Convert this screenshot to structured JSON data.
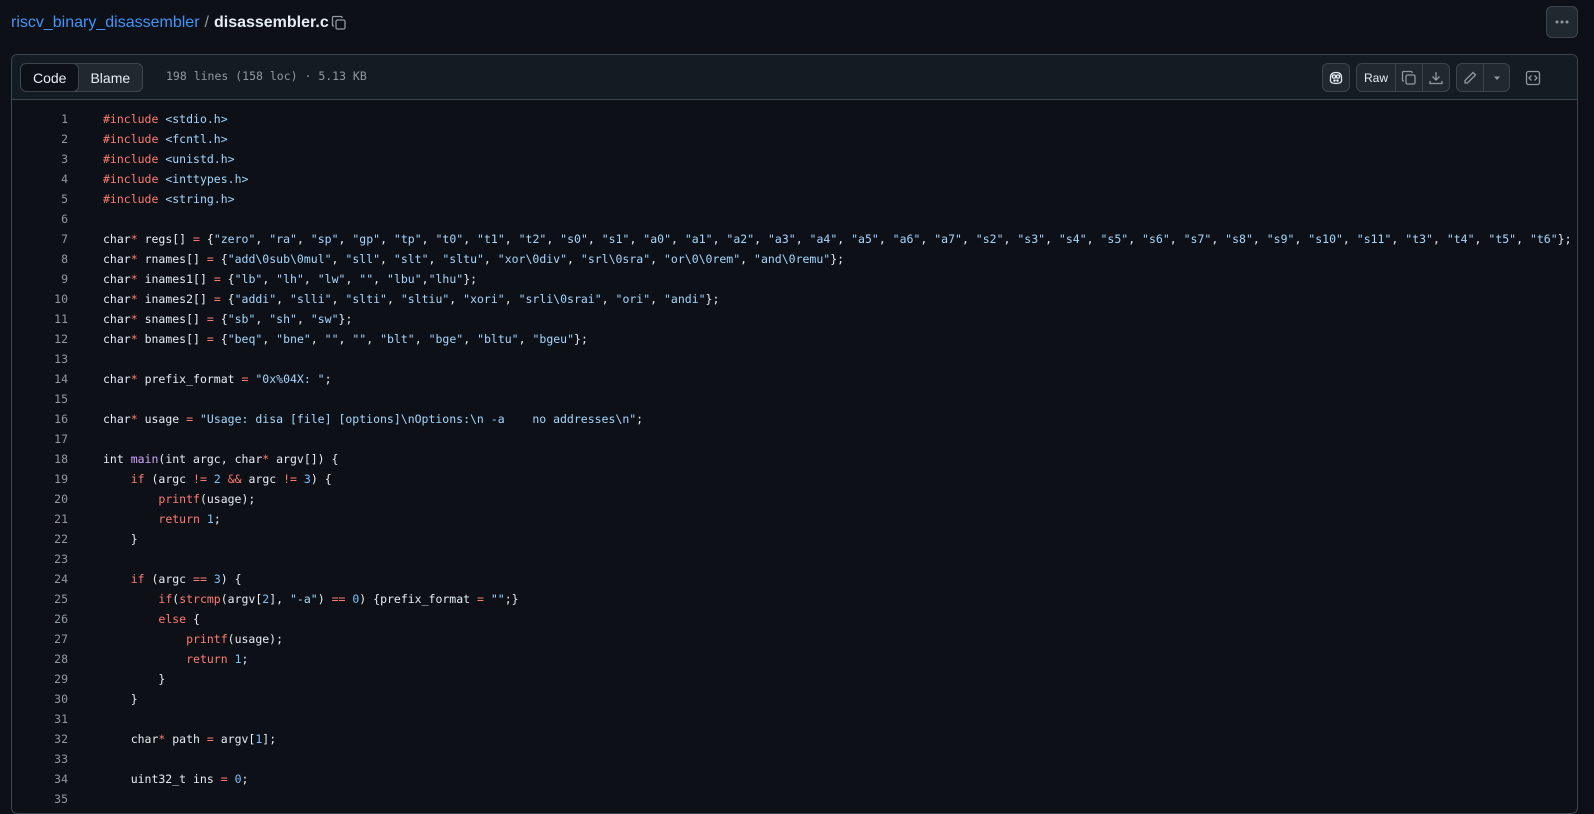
{
  "breadcrumb": {
    "repo": "riscv_binary_disassembler",
    "separator": "/",
    "file": "disassembler.c"
  },
  "icons": {
    "copy_path": "copy-icon",
    "more": "kebab-horizontal-icon",
    "copilot": "copilot-icon",
    "copy_raw": "copy-icon",
    "download": "download-icon",
    "edit": "pencil-icon",
    "dropdown": "triangle-down-icon",
    "symbols": "code-square-icon"
  },
  "tabs": {
    "code": "Code",
    "blame": "Blame",
    "active": "code"
  },
  "file_info": "198 lines (158 loc) · 5.13 KB",
  "toolbar": {
    "raw": "Raw"
  },
  "colors": {
    "keyword": "#ff7b72",
    "string": "#a5d6ff",
    "number": "#79c0ff",
    "function": "#d2a8ff",
    "link": "#4493f8"
  },
  "code_lines": [
    {
      "n": "1",
      "t": [
        [
          "kw",
          "#include"
        ],
        [
          "",
          "&nbsp;"
        ],
        [
          "str",
          "<stdio.h>"
        ]
      ]
    },
    {
      "n": "2",
      "t": [
        [
          "kw",
          "#include"
        ],
        [
          "",
          "&nbsp;"
        ],
        [
          "str",
          "<fcntl.h>"
        ]
      ]
    },
    {
      "n": "3",
      "t": [
        [
          "kw",
          "#include"
        ],
        [
          "",
          "&nbsp;"
        ],
        [
          "str",
          "<unistd.h>"
        ]
      ]
    },
    {
      "n": "4",
      "t": [
        [
          "kw",
          "#include"
        ],
        [
          "",
          "&nbsp;"
        ],
        [
          "str",
          "<inttypes.h>"
        ]
      ]
    },
    {
      "n": "5",
      "t": [
        [
          "kw",
          "#include"
        ],
        [
          "",
          "&nbsp;"
        ],
        [
          "str",
          "<string.h>"
        ]
      ]
    },
    {
      "n": "6",
      "t": []
    },
    {
      "n": "7",
      "t": [
        [
          "",
          "char"
        ],
        [
          "kw",
          "*"
        ],
        [
          "",
          "&nbsp;regs[] "
        ],
        [
          "kw",
          "="
        ],
        [
          "",
          "&nbsp;{"
        ],
        [
          "str",
          "\"zero\""
        ],
        [
          "",
          ", "
        ],
        [
          "str",
          "\"ra\""
        ],
        [
          "",
          ", "
        ],
        [
          "str",
          "\"sp\""
        ],
        [
          "",
          ", "
        ],
        [
          "str",
          "\"gp\""
        ],
        [
          "",
          ", "
        ],
        [
          "str",
          "\"tp\""
        ],
        [
          "",
          ", "
        ],
        [
          "str",
          "\"t0\""
        ],
        [
          "",
          ", "
        ],
        [
          "str",
          "\"t1\""
        ],
        [
          "",
          ", "
        ],
        [
          "str",
          "\"t2\""
        ],
        [
          "",
          ", "
        ],
        [
          "str",
          "\"s0\""
        ],
        [
          "",
          ", "
        ],
        [
          "str",
          "\"s1\""
        ],
        [
          "",
          ", "
        ],
        [
          "str",
          "\"a0\""
        ],
        [
          "",
          ", "
        ],
        [
          "str",
          "\"a1\""
        ],
        [
          "",
          ", "
        ],
        [
          "str",
          "\"a2\""
        ],
        [
          "",
          ", "
        ],
        [
          "str",
          "\"a3\""
        ],
        [
          "",
          ", "
        ],
        [
          "str",
          "\"a4\""
        ],
        [
          "",
          ", "
        ],
        [
          "str",
          "\"a5\""
        ],
        [
          "",
          ", "
        ],
        [
          "str",
          "\"a6\""
        ],
        [
          "",
          ", "
        ],
        [
          "str",
          "\"a7\""
        ],
        [
          "",
          ", "
        ],
        [
          "str",
          "\"s2\""
        ],
        [
          "",
          ", "
        ],
        [
          "str",
          "\"s3\""
        ],
        [
          "",
          ", "
        ],
        [
          "str",
          "\"s4\""
        ],
        [
          "",
          ", "
        ],
        [
          "str",
          "\"s5\""
        ],
        [
          "",
          ", "
        ],
        [
          "str",
          "\"s6\""
        ],
        [
          "",
          ", "
        ],
        [
          "str",
          "\"s7\""
        ],
        [
          "",
          ", "
        ],
        [
          "str",
          "\"s8\""
        ],
        [
          "",
          ", "
        ],
        [
          "str",
          "\"s9\""
        ],
        [
          "",
          ", "
        ],
        [
          "str",
          "\"s10\""
        ],
        [
          "",
          ", "
        ],
        [
          "str",
          "\"s11\""
        ],
        [
          "",
          ", "
        ],
        [
          "str",
          "\"t3\""
        ],
        [
          "",
          ", "
        ],
        [
          "str",
          "\"t4\""
        ],
        [
          "",
          ", "
        ],
        [
          "str",
          "\"t5\""
        ],
        [
          "",
          ", "
        ],
        [
          "str",
          "\"t6\""
        ],
        [
          "",
          "};"
        ]
      ]
    },
    {
      "n": "8",
      "t": [
        [
          "",
          "char"
        ],
        [
          "kw",
          "*"
        ],
        [
          "",
          "&nbsp;rnames[] "
        ],
        [
          "kw",
          "="
        ],
        [
          "",
          "&nbsp;{"
        ],
        [
          "str",
          "\"add\\0sub\\0mul\""
        ],
        [
          "",
          ", "
        ],
        [
          "str",
          "\"sll\""
        ],
        [
          "",
          ", "
        ],
        [
          "str",
          "\"slt\""
        ],
        [
          "",
          ", "
        ],
        [
          "str",
          "\"sltu\""
        ],
        [
          "",
          ", "
        ],
        [
          "str",
          "\"xor\\0div\""
        ],
        [
          "",
          ", "
        ],
        [
          "str",
          "\"srl\\0sra\""
        ],
        [
          "",
          ", "
        ],
        [
          "str",
          "\"or\\0\\0rem\""
        ],
        [
          "",
          ", "
        ],
        [
          "str",
          "\"and\\0remu\""
        ],
        [
          "",
          "};"
        ]
      ]
    },
    {
      "n": "9",
      "t": [
        [
          "",
          "char"
        ],
        [
          "kw",
          "*"
        ],
        [
          "",
          "&nbsp;inames1[] "
        ],
        [
          "kw",
          "="
        ],
        [
          "",
          "&nbsp;{"
        ],
        [
          "str",
          "\"lb\""
        ],
        [
          "",
          ", "
        ],
        [
          "str",
          "\"lh\""
        ],
        [
          "",
          ", "
        ],
        [
          "str",
          "\"lw\""
        ],
        [
          "",
          ", "
        ],
        [
          "str",
          "\"\""
        ],
        [
          "",
          ", "
        ],
        [
          "str",
          "\"lbu\""
        ],
        [
          "",
          ","
        ],
        [
          "str",
          "\"lhu\""
        ],
        [
          "",
          "};"
        ]
      ]
    },
    {
      "n": "10",
      "t": [
        [
          "",
          "char"
        ],
        [
          "kw",
          "*"
        ],
        [
          "",
          "&nbsp;inames2[] "
        ],
        [
          "kw",
          "="
        ],
        [
          "",
          "&nbsp;{"
        ],
        [
          "str",
          "\"addi\""
        ],
        [
          "",
          ", "
        ],
        [
          "str",
          "\"slli\""
        ],
        [
          "",
          ", "
        ],
        [
          "str",
          "\"slti\""
        ],
        [
          "",
          ", "
        ],
        [
          "str",
          "\"sltiu\""
        ],
        [
          "",
          ", "
        ],
        [
          "str",
          "\"xori\""
        ],
        [
          "",
          ", "
        ],
        [
          "str",
          "\"srli\\0srai\""
        ],
        [
          "",
          ", "
        ],
        [
          "str",
          "\"ori\""
        ],
        [
          "",
          ", "
        ],
        [
          "str",
          "\"andi\""
        ],
        [
          "",
          "};"
        ]
      ]
    },
    {
      "n": "11",
      "t": [
        [
          "",
          "char"
        ],
        [
          "kw",
          "*"
        ],
        [
          "",
          "&nbsp;snames[] "
        ],
        [
          "kw",
          "="
        ],
        [
          "",
          "&nbsp;{"
        ],
        [
          "str",
          "\"sb\""
        ],
        [
          "",
          ", "
        ],
        [
          "str",
          "\"sh\""
        ],
        [
          "",
          ", "
        ],
        [
          "str",
          "\"sw\""
        ],
        [
          "",
          "};"
        ]
      ]
    },
    {
      "n": "12",
      "t": [
        [
          "",
          "char"
        ],
        [
          "kw",
          "*"
        ],
        [
          "",
          "&nbsp;bnames[] "
        ],
        [
          "kw",
          "="
        ],
        [
          "",
          "&nbsp;{"
        ],
        [
          "str",
          "\"beq\""
        ],
        [
          "",
          ", "
        ],
        [
          "str",
          "\"bne\""
        ],
        [
          "",
          ", "
        ],
        [
          "str",
          "\"\""
        ],
        [
          "",
          ", "
        ],
        [
          "str",
          "\"\""
        ],
        [
          "",
          ", "
        ],
        [
          "str",
          "\"blt\""
        ],
        [
          "",
          ", "
        ],
        [
          "str",
          "\"bge\""
        ],
        [
          "",
          ", "
        ],
        [
          "str",
          "\"bltu\""
        ],
        [
          "",
          ", "
        ],
        [
          "str",
          "\"bgeu\""
        ],
        [
          "",
          "};"
        ]
      ]
    },
    {
      "n": "13",
      "t": []
    },
    {
      "n": "14",
      "t": [
        [
          "",
          "char"
        ],
        [
          "kw",
          "*"
        ],
        [
          "",
          "&nbsp;prefix_format "
        ],
        [
          "kw",
          "="
        ],
        [
          "",
          "&nbsp;"
        ],
        [
          "str",
          "\"0x%04X: \""
        ],
        [
          "",
          ";"
        ]
      ]
    },
    {
      "n": "15",
      "t": []
    },
    {
      "n": "16",
      "t": [
        [
          "",
          "char"
        ],
        [
          "kw",
          "*"
        ],
        [
          "",
          "&nbsp;usage "
        ],
        [
          "kw",
          "="
        ],
        [
          "",
          "&nbsp;"
        ],
        [
          "str",
          "\"Usage: disa [file] [options]\\nOptions:\\n -a    no addresses\\n\""
        ],
        [
          "",
          ";"
        ]
      ]
    },
    {
      "n": "17",
      "t": []
    },
    {
      "n": "18",
      "t": [
        [
          "",
          "int "
        ],
        [
          "fn",
          "main"
        ],
        [
          "",
          "(int argc, char"
        ],
        [
          "kw",
          "*"
        ],
        [
          "",
          "&nbsp;argv[]) {"
        ]
      ]
    },
    {
      "n": "19",
      "t": [
        [
          "",
          "    "
        ],
        [
          "kw",
          "if"
        ],
        [
          "",
          "&nbsp;(argc "
        ],
        [
          "kw",
          "!="
        ],
        [
          "",
          "&nbsp;"
        ],
        [
          "num",
          "2"
        ],
        [
          "",
          "&nbsp;"
        ],
        [
          "kw",
          "&&"
        ],
        [
          "",
          "&nbsp;argc "
        ],
        [
          "kw",
          "!="
        ],
        [
          "",
          "&nbsp;"
        ],
        [
          "num",
          "3"
        ],
        [
          "",
          ") {"
        ]
      ]
    },
    {
      "n": "20",
      "t": [
        [
          "",
          "        "
        ],
        [
          "kw",
          "printf"
        ],
        [
          "",
          "(usage);"
        ]
      ]
    },
    {
      "n": "21",
      "t": [
        [
          "",
          "        "
        ],
        [
          "kw",
          "return"
        ],
        [
          "",
          "&nbsp;"
        ],
        [
          "num",
          "1"
        ],
        [
          "",
          ";"
        ]
      ]
    },
    {
      "n": "22",
      "t": [
        [
          "",
          "    }"
        ]
      ]
    },
    {
      "n": "23",
      "t": []
    },
    {
      "n": "24",
      "t": [
        [
          "",
          "    "
        ],
        [
          "kw",
          "if"
        ],
        [
          "",
          "&nbsp;(argc "
        ],
        [
          "kw",
          "=="
        ],
        [
          "",
          "&nbsp;"
        ],
        [
          "num",
          "3"
        ],
        [
          "",
          ") {"
        ]
      ]
    },
    {
      "n": "25",
      "t": [
        [
          "",
          "        "
        ],
        [
          "kw",
          "if"
        ],
        [
          "",
          "("
        ],
        [
          "kw",
          "strcmp"
        ],
        [
          "",
          "(argv["
        ],
        [
          "num",
          "2"
        ],
        [
          "",
          "], "
        ],
        [
          "str",
          "\"-a\""
        ],
        [
          "",
          ") "
        ],
        [
          "kw",
          "=="
        ],
        [
          "",
          "&nbsp;"
        ],
        [
          "num",
          "0"
        ],
        [
          "",
          ") {prefix_format "
        ],
        [
          "kw",
          "="
        ],
        [
          "",
          "&nbsp;"
        ],
        [
          "str",
          "\"\""
        ],
        [
          "",
          ";}"
        ]
      ]
    },
    {
      "n": "26",
      "t": [
        [
          "",
          "        "
        ],
        [
          "kw",
          "else"
        ],
        [
          "",
          "&nbsp;{"
        ]
      ]
    },
    {
      "n": "27",
      "t": [
        [
          "",
          "            "
        ],
        [
          "kw",
          "printf"
        ],
        [
          "",
          "(usage);"
        ]
      ]
    },
    {
      "n": "28",
      "t": [
        [
          "",
          "            "
        ],
        [
          "kw",
          "return"
        ],
        [
          "",
          "&nbsp;"
        ],
        [
          "num",
          "1"
        ],
        [
          "",
          ";"
        ]
      ]
    },
    {
      "n": "29",
      "t": [
        [
          "",
          "        }"
        ]
      ]
    },
    {
      "n": "30",
      "t": [
        [
          "",
          "    }"
        ]
      ]
    },
    {
      "n": "31",
      "t": []
    },
    {
      "n": "32",
      "t": [
        [
          "",
          "    char"
        ],
        [
          "kw",
          "*"
        ],
        [
          "",
          "&nbsp;path "
        ],
        [
          "kw",
          "="
        ],
        [
          "",
          "&nbsp;argv["
        ],
        [
          "num",
          "1"
        ],
        [
          "",
          "];"
        ]
      ]
    },
    {
      "n": "33",
      "t": []
    },
    {
      "n": "34",
      "t": [
        [
          "",
          "    uint32_t ins "
        ],
        [
          "kw",
          "="
        ],
        [
          "",
          "&nbsp;"
        ],
        [
          "num",
          "0"
        ],
        [
          "",
          ";"
        ]
      ]
    },
    {
      "n": "35",
      "t": []
    }
  ]
}
